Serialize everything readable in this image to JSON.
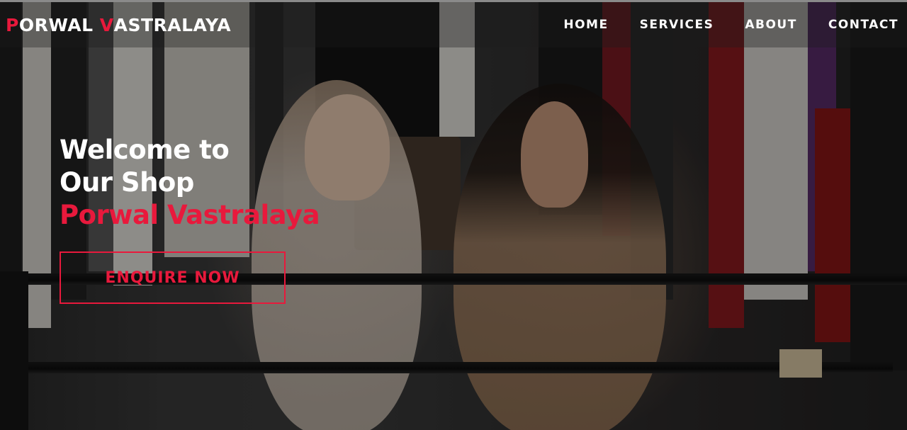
{
  "brand": {
    "first_initial": "P",
    "first_rest": "ORWAL ",
    "second_initial": "V",
    "second_rest": "ASTRALAYA"
  },
  "nav": {
    "items": [
      {
        "label": "HOME"
      },
      {
        "label": "SERVICES"
      },
      {
        "label": "ABOUT"
      },
      {
        "label": "CONTACT"
      }
    ]
  },
  "hero": {
    "line1": "Welcome to",
    "line2": "Our Shop",
    "brand_name": "Porwal Vastralaya",
    "cta_label": "ENQUIRE NOW",
    "background_image": "store-interior-two-women-shopping"
  },
  "colors": {
    "accent": "#e8193c",
    "text": "#ffffff",
    "overlay": "#000000"
  }
}
